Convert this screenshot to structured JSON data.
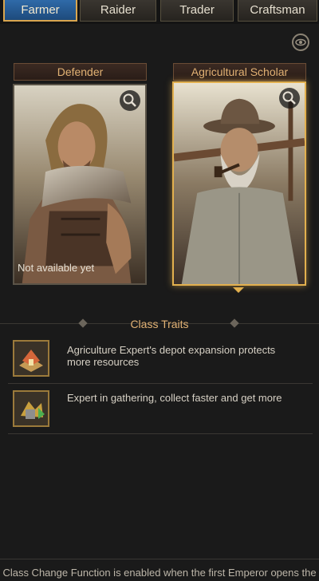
{
  "tabs": [
    {
      "label": "Farmer",
      "active": true
    },
    {
      "label": "Raider"
    },
    {
      "label": "Trader"
    },
    {
      "label": "Craftsman"
    }
  ],
  "cards": [
    {
      "title": "Defender",
      "status": "Not available yet",
      "selected": false
    },
    {
      "title": "Agricultural Scholar",
      "selected": true
    }
  ],
  "traits": {
    "title": "Class Traits",
    "items": [
      {
        "text": "Agriculture Expert's depot expansion protects more resources",
        "icon": "warehouse-icon"
      },
      {
        "text": "Expert in gathering, collect faster and get more",
        "icon": "gathering-icon"
      }
    ]
  },
  "footer": {
    "text": "Class Change Function is enabled when the first Emperor opens the"
  },
  "colors": {
    "accent": "#e2b274",
    "active_tab": "#2f6aa8",
    "selected_border": "#e2b04e"
  }
}
